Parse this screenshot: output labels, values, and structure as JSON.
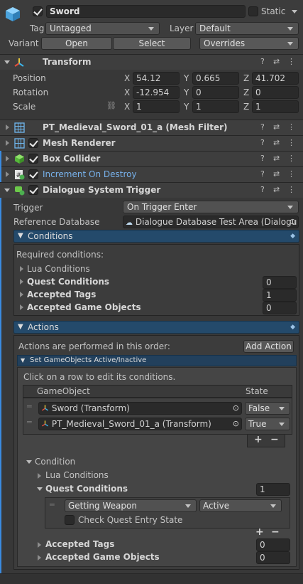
{
  "object": {
    "name": "Sword",
    "active": true,
    "static_label": "Static",
    "tag_label": "Tag",
    "tag_value": "Untagged",
    "layer_label": "Layer",
    "layer_value": "Default",
    "variant_label": "Variant",
    "open_label": "Open",
    "select_label": "Select",
    "overrides_label": "Overrides"
  },
  "transform": {
    "title": "Transform",
    "position_label": "Position",
    "rotation_label": "Rotation",
    "scale_label": "Scale",
    "x": "X",
    "y": "Y",
    "z": "Z",
    "position": [
      "54.12",
      "0.665",
      "41.702"
    ],
    "rotation": [
      "-12.954",
      "0",
      "0"
    ],
    "scale": [
      "1",
      "1",
      "1"
    ]
  },
  "components": [
    {
      "title": "PT_Medieval_Sword_01_a (Mesh Filter)"
    },
    {
      "title": "Mesh Renderer"
    },
    {
      "title": "Box Collider"
    },
    {
      "title": "Increment On Destroy"
    },
    {
      "title": "Dialogue System Trigger"
    }
  ],
  "trigger": {
    "trigger_label": "Trigger",
    "trigger_value": "On Trigger Enter",
    "db_label": "Reference Database",
    "db_value": "Dialogue Database Test Area (Dialogu"
  },
  "conditions": {
    "header": "Conditions",
    "required": "Required conditions:",
    "lua": "Lua Conditions",
    "quest_label": "Quest Conditions",
    "quest_value": "0",
    "tags_label": "Accepted Tags",
    "tags_value": "1",
    "gos_label": "Accepted Game Objects",
    "gos_value": "0"
  },
  "actions": {
    "header": "Actions",
    "order_text": "Actions are performed in this order:",
    "add_action": "Add Action",
    "set_go_header": "Set GameObjects Active/Inactive",
    "click_hint": "Click on a row to edit its conditions.",
    "col_go": "GameObject",
    "col_state": "State",
    "rows": [
      {
        "object": "Sword (Transform)",
        "state": "False"
      },
      {
        "object": "PT_Medieval_Sword_01_a (Transform)",
        "state": "True"
      }
    ],
    "plus": "+",
    "minus": "−",
    "condition_label": "Condition",
    "lua": "Lua Conditions",
    "quest_label": "Quest Conditions",
    "quest_value": "1",
    "quest_name": "Getting Weapon",
    "quest_state": "Active",
    "check_entry": "Check Quest Entry State",
    "tags_label": "Accepted Tags",
    "tags_value": "0",
    "gos_label": "Accepted Game Objects",
    "gos_value": "0"
  }
}
